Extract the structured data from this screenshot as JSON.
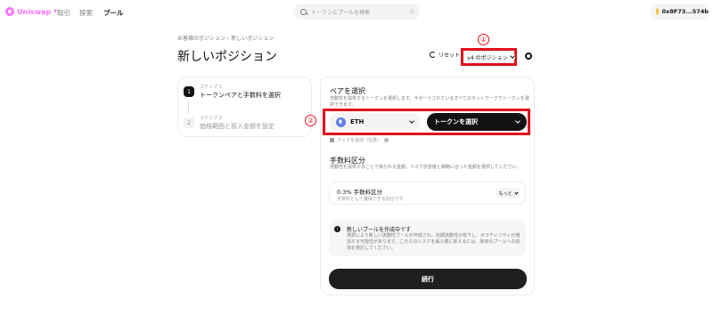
{
  "nav": {
    "brand": "Uniswap",
    "links": [
      "取引",
      "探索",
      "プール"
    ],
    "search_placeholder": "トークンとプールを検索",
    "search_shortcut": "/",
    "wallet_address": "0x8F73...574b"
  },
  "header": {
    "breadcrumb": "お客様のポジション › 新しいポジション",
    "title": "新しいポジション",
    "reset_label": "リセット",
    "version_label": "v4 のポジション"
  },
  "annotations": {
    "marker_1": "①",
    "marker_2": "②",
    "highlight_color": "#e3101c"
  },
  "steps": [
    {
      "number": "1",
      "label": "ステップ 1",
      "title": "トークンペアと手数料を選択"
    },
    {
      "number": "2",
      "label": "ステップ 2",
      "title": "価格範囲と預入金額を設定"
    }
  ],
  "pair": {
    "title": "ペアを選択",
    "description": "流動性を提供するトークンを選択します。サポートされているすべてのネットワークでトークンを選択できます。",
    "token_a": "ETH",
    "token_b": "トークンを選択",
    "hook_label": "フックを追加（任意）"
  },
  "fee": {
    "title": "手数料区分",
    "description": "流動性を提供することで得られる金額。リスク許容度と戦略に合った金額を選択してください。",
    "tier_title": "0.3% 手数料区分",
    "tier_subtitle": "手数料として獲得できる割合です",
    "more_label": "もっと"
  },
  "notice": {
    "title": "新しいプールを作成中です",
    "body": "選択により新しい流動性プールが作成され、初期流動性が低下し、ボラティリティが増加する可能性があります。これらのリスクを最小限に抑えるには、既存のプールへの追加を検討してください。"
  },
  "continue_label": "続行",
  "colors": {
    "brand": "#fc72ff",
    "primary_button": "#1f1f1f"
  }
}
